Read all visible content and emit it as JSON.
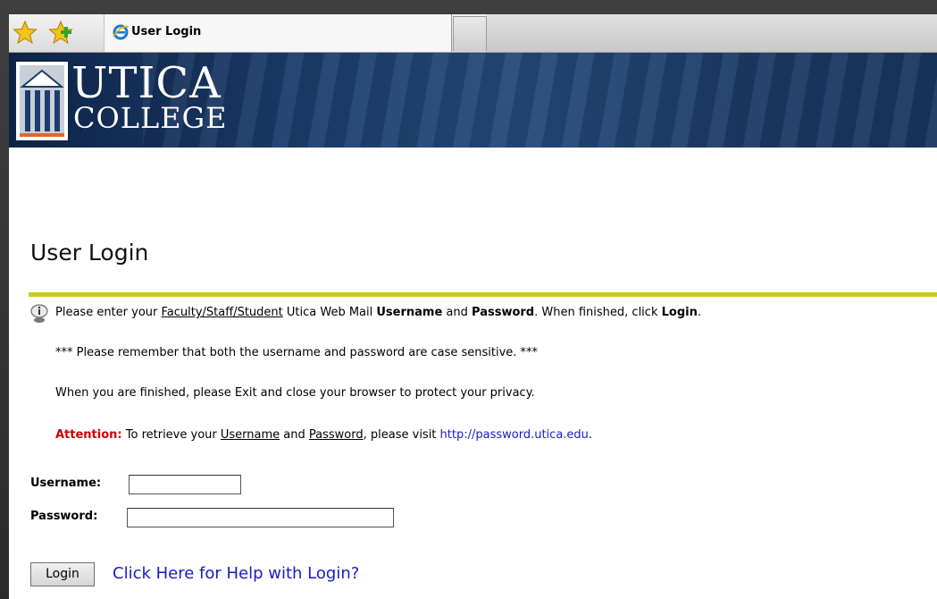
{
  "browser": {
    "tab_title": "User Login"
  },
  "banner": {
    "logo_line1": "UTICA",
    "logo_line2": "COLLEGE"
  },
  "page": {
    "heading": "User Login",
    "info": {
      "prefix": "Please enter your ",
      "link_faculty": "Faculty/Staff/Student",
      "mid1": " Utica Web Mail ",
      "username_bold": "Username",
      "and": " and ",
      "password_bold": "Password",
      "mid2": ". When finished, click ",
      "login_bold": "Login",
      "end": "."
    },
    "case_notice": "*** Please remember that both the username and password are case sensitive. ***",
    "exit_notice": "When you are finished, please Exit and close your browser to protect your privacy.",
    "attention": {
      "label": "Attention:",
      "text1": " To retrieve your ",
      "username_link": "Username",
      "and": " and ",
      "password_link": "Password",
      "text2": ", please visit ",
      "url": "http://password.utica.edu",
      "end": "."
    },
    "form": {
      "username_label": "Username:",
      "username_value": "",
      "password_label": "Password:",
      "password_value": "",
      "login_button": "Login",
      "help_link": "Click Here for Help with Login?"
    }
  },
  "colors": {
    "rule": "#c8ce14",
    "attention": "#d00000",
    "link": "#1a1ac8",
    "banner": "#1c3c6c"
  }
}
